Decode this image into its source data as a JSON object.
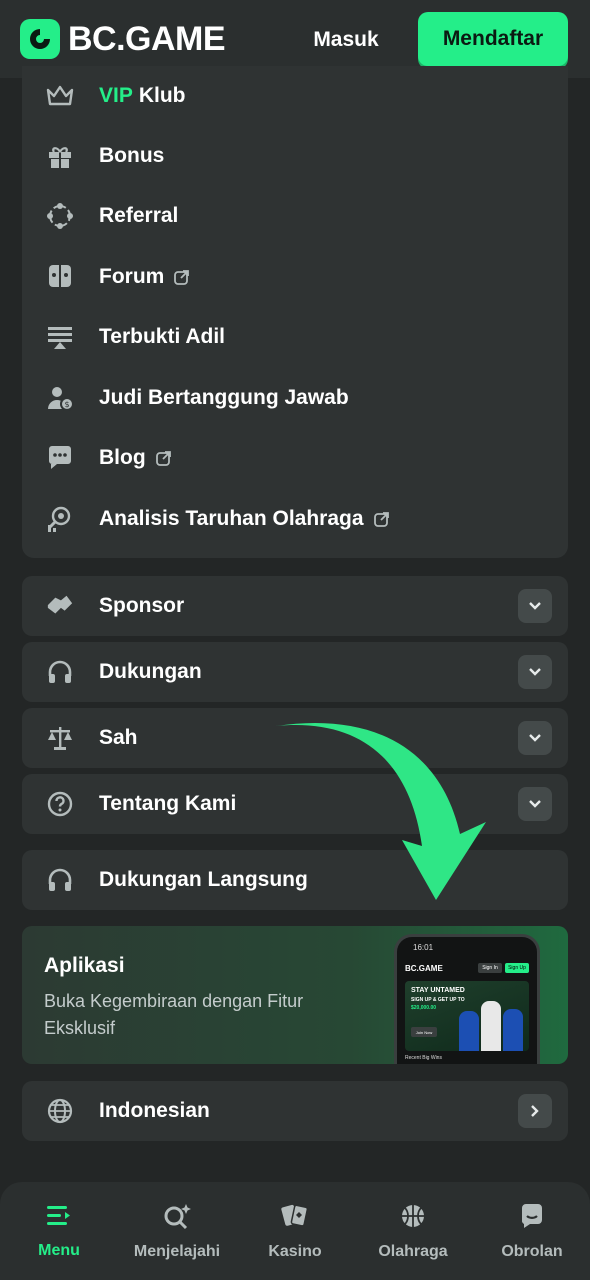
{
  "header": {
    "logo_text": "BC.GAME",
    "signin_label": "Masuk",
    "signup_label": "Mendaftar"
  },
  "menu": {
    "items": [
      {
        "label_accent": "VIP",
        "label": "Klub",
        "icon": "crown-icon"
      },
      {
        "label": "Bonus",
        "icon": "gift-icon"
      },
      {
        "label": "Referral",
        "icon": "referral-icon"
      },
      {
        "label": "Forum",
        "icon": "forum-icon",
        "external": true
      },
      {
        "label": "Terbukti Adil",
        "icon": "fairness-icon"
      },
      {
        "label": "Judi Bertanggung Jawab",
        "icon": "responsible-icon"
      },
      {
        "label": "Blog",
        "icon": "chat-icon",
        "external": true
      },
      {
        "label": "Analisis Taruhan Olahraga",
        "icon": "analysis-icon",
        "external": true
      }
    ]
  },
  "sections": [
    {
      "label": "Sponsor",
      "icon": "handshake-icon"
    },
    {
      "label": "Dukungan",
      "icon": "headphones-icon"
    },
    {
      "label": "Sah",
      "icon": "scale-icon"
    },
    {
      "label": "Tentang Kami",
      "icon": "question-icon"
    }
  ],
  "live_support": {
    "label": "Dukungan Langsung",
    "icon": "headphones-icon"
  },
  "app_banner": {
    "title": "Aplikasi",
    "subtitle": "Buka Kegembiraan dengan Fitur Eksklusif",
    "phone": {
      "status_time": "16:01",
      "logo": "BC.GAME",
      "signin": "Sign In",
      "signup": "Sign Up",
      "hero_title": "STAY UNTAMED",
      "hero_sub": "SIGN UP & GET UP TO",
      "hero_amount": "$20,000.00",
      "join": "Join Now",
      "wins": "Recent Big Wins"
    }
  },
  "language": {
    "label": "Indonesian",
    "icon": "globe-icon"
  },
  "bottom_nav": {
    "items": [
      {
        "label": "Menu",
        "icon": "menu-icon",
        "active": true
      },
      {
        "label": "Menjelajahi",
        "icon": "explore-icon"
      },
      {
        "label": "Kasino",
        "icon": "cards-icon"
      },
      {
        "label": "Olahraga",
        "icon": "basketball-icon"
      },
      {
        "label": "Obrolan",
        "icon": "chat-bubble-icon"
      }
    ]
  },
  "colors": {
    "accent": "#24ee89",
    "background": "#232626",
    "card": "#2f3333"
  }
}
